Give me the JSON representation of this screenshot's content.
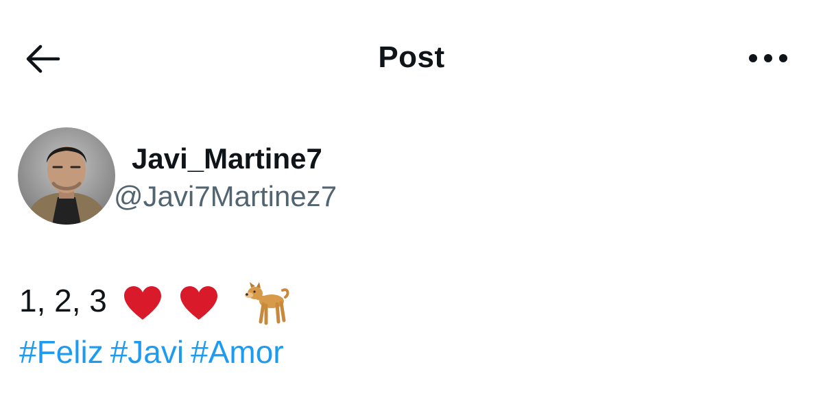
{
  "header": {
    "title": "Post",
    "back_icon": "arrow-left-icon",
    "more_icon": "more-horizontal-icon"
  },
  "author": {
    "display_name": "Javi_Martine7",
    "handle": "@Javi7Martinez7"
  },
  "post": {
    "text": "1, 2, 3",
    "emojis": [
      "red-heart",
      "red-heart",
      "dog"
    ],
    "hashtags": [
      "#Feliz",
      "#Javi",
      "#Amor"
    ]
  },
  "colors": {
    "text": "#0f1419",
    "secondary": "#536471",
    "link": "#1d9bf0",
    "heart": "#d91a2a"
  }
}
